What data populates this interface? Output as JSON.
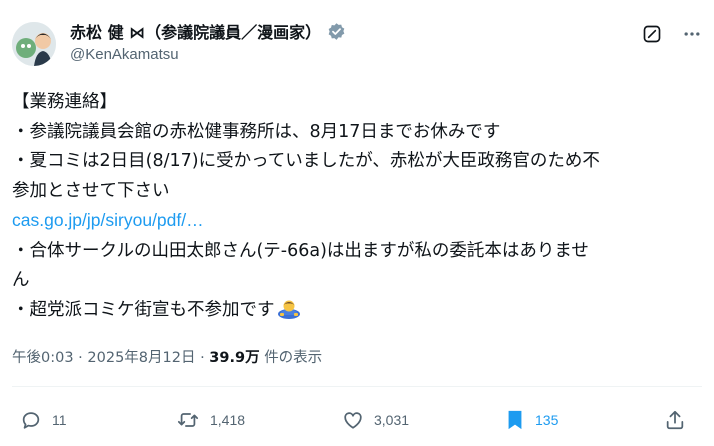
{
  "author": {
    "display_name": "赤松 健 ⋈（参議院議員／漫画家）",
    "handle": "@KenAkamatsu"
  },
  "tweet": {
    "lines": [
      "【業務連絡】",
      "・参議院議員会館の赤松健事務所は、8月17日までお休みです",
      "・夏コミは2日目(8/17)に受かっていましたが、赤松が大臣政務官のため不",
      "参加とさせて下さい",
      "cas.go.jp/jp/siryou/pdf/…",
      "・合体サークルの山田太郎さん(テ-66a)は出ますが私の委託本はありませ",
      "ん",
      "・超党派コミケ街宣も不参加です"
    ]
  },
  "meta": {
    "time": "午後0:03",
    "separator": "·",
    "date": "2025年8月12日",
    "views_count": "39.9万",
    "views_label": "件の表示"
  },
  "actions": {
    "replies": "11",
    "reposts": "1,418",
    "likes": "3,031",
    "bookmarks": "135"
  },
  "colors": {
    "link": "#1d9bf0",
    "text": "#0f1419",
    "secondary": "#536471",
    "bookmark_active": "#1d9bf0"
  },
  "icons": [
    "verified-badge-icon",
    "grok-icon",
    "more-icon",
    "reply-icon",
    "repost-icon",
    "like-icon",
    "bookmark-icon",
    "share-icon",
    "bowing-person-emoji"
  ]
}
